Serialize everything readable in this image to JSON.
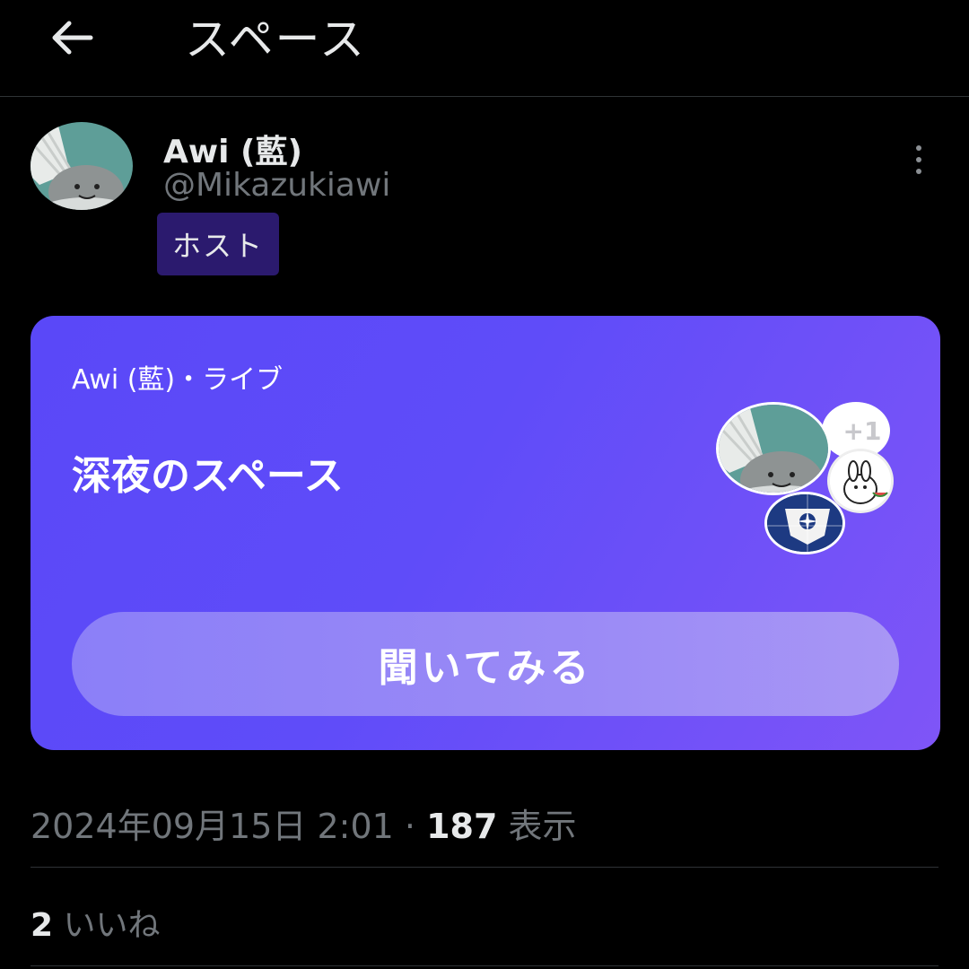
{
  "header": {
    "back_icon": "arrow-left-icon",
    "title": "スペース"
  },
  "host": {
    "name": "Awi (藍)",
    "handle": "@Mikazukiawi",
    "badge": "ホスト",
    "more_icon": "more-vertical-icon"
  },
  "card": {
    "subtitle": "Awi (藍)・ライブ",
    "title": "深夜のスペース",
    "listen_button": "聞いてみる",
    "extra_listeners": "+1",
    "gradient_start": "#5a48f8",
    "gradient_end": "#7f55f7"
  },
  "meta": {
    "datetime": "2024年09月15日 2:01 · ",
    "views_count": "187",
    "views_label": " 表示"
  },
  "likes": {
    "count": "2",
    "label": " いいね"
  }
}
